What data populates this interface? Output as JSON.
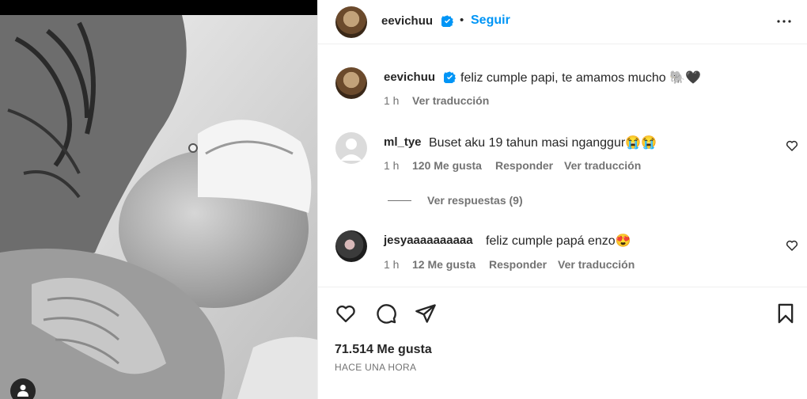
{
  "post": {
    "owner": "eevichuu",
    "follow_label": "Seguir",
    "separator": "•"
  },
  "caption": {
    "username": "eevichuu",
    "text": "feliz cumple papi, te amamos mucho 🐘🖤",
    "time": "1 h",
    "translate": "Ver traducción"
  },
  "comments": [
    {
      "username": "ml_tye",
      "text": "Buset aku 19 tahun masi nganggur😭😭",
      "time": "1 h",
      "likes": "120 Me gusta",
      "reply": "Responder",
      "translate": "Ver traducción",
      "replies_label": "Ver respuestas (9)"
    },
    {
      "username": "jesyaaaaaaaaaa",
      "text": "feliz cumple papá enzo😍",
      "time": "1 h",
      "likes": "12 Me gusta",
      "reply": "Responder",
      "translate": "Ver traducción"
    }
  ],
  "footer": {
    "likes": "71.514 Me gusta",
    "time": "HACE UNA HORA"
  },
  "icons": {
    "verified": "verified-badge-icon",
    "more": "more-options-icon",
    "like": "heart-icon",
    "comment": "comment-icon",
    "share": "paper-plane-icon",
    "save": "bookmark-icon",
    "tag": "user-tag-icon"
  },
  "colors": {
    "link": "#0095f6",
    "verified": "#0095f6",
    "muted": "#737373",
    "text": "#262626"
  }
}
